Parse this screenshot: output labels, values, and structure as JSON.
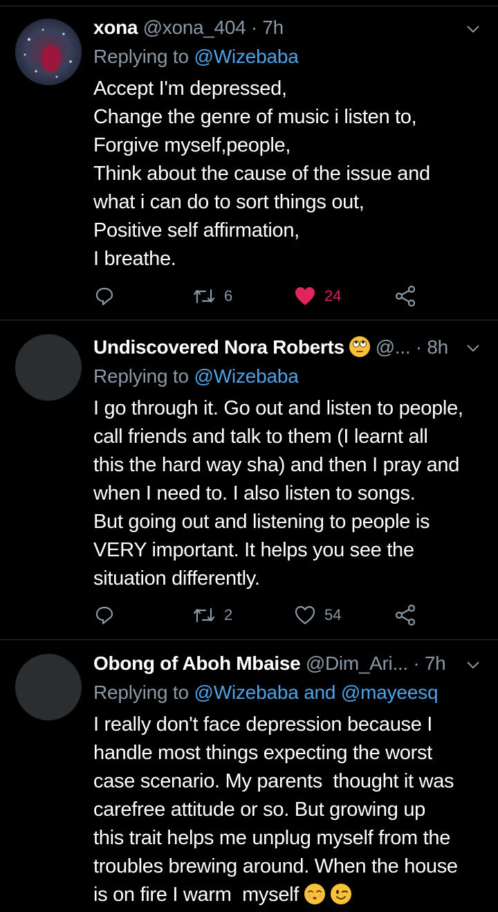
{
  "tweets": [
    {
      "display_name": "xona",
      "handle": "@xona_404",
      "time": "· 7h",
      "replying_prefix": "Replying to ",
      "replying_to": "@Wizebaba",
      "replying_mid": "",
      "replying_to_2": "",
      "lines": [
        "Accept I'm depressed,",
        "Change the genre of music i listen to,",
        "Forgive myself,people,",
        "Think about the cause of the issue and",
        "what i can do to sort things out,",
        "Positive self affirmation,",
        "I breathe."
      ],
      "retweets": "6",
      "likes": "24",
      "liked": true
    },
    {
      "display_name": "Undiscovered Nora Roberts",
      "name_emoji": "face-with-rolling-eyes",
      "handle": "@...",
      "time": "· 8h",
      "replying_prefix": "Replying to ",
      "replying_to": "@Wizebaba",
      "replying_mid": "",
      "replying_to_2": "",
      "lines": [
        "I go through it. Go out and listen to people,",
        "call friends and talk to them (I learnt all",
        "this the hard way sha) and then I pray and",
        "when I need to. I also listen to songs.",
        "But going out and listening to people is",
        "VERY important. It helps you see the",
        "situation differently."
      ],
      "retweets": "2",
      "likes": "54",
      "liked": false
    },
    {
      "display_name": "Obong of Aboh Mbaise",
      "handle": "@Dim_Ari...",
      "time": "· 7h",
      "replying_prefix": "Replying to ",
      "replying_to": "@Wizebaba",
      "replying_mid": " and ",
      "replying_to_2": "@mayeesq",
      "lines": [
        "I really don't face depression because I",
        "handle most things expecting the worst",
        "case scenario. My parents  thought it was",
        "carefree attitude or so. But growing up",
        "this trait helps me unplug myself from the",
        "troubles brewing around. When the house",
        "is on fire I warm  myself"
      ],
      "trailing_emojis": [
        "kissing-face-with-smiling-eyes",
        "winking-face"
      ]
    }
  ],
  "colors": {
    "background": "#000000",
    "text": "#ffffff",
    "secondary": "#8b98a5",
    "link": "#4fa3e8",
    "like_active": "#e0245e",
    "divider": "#2f3336"
  }
}
